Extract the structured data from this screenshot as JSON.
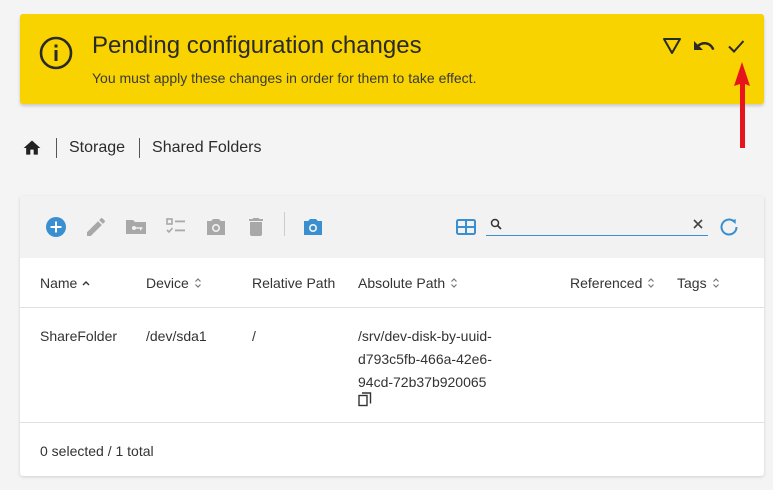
{
  "banner": {
    "title": "Pending configuration changes",
    "subtitle": "You must apply these changes in order for them to take effect.",
    "icons": [
      "info-icon",
      "filter-icon",
      "undo-icon",
      "check-icon"
    ],
    "bg_color": "#f8d300"
  },
  "breadcrumb": {
    "home_icon": "home-icon",
    "items": [
      "Storage",
      "Shared Folders"
    ]
  },
  "toolbar": {
    "icons": [
      "add-icon",
      "edit-icon",
      "folder-key-icon",
      "checklist-icon",
      "snapshot-icon",
      "delete-icon",
      "snapshot-active-icon",
      "grid-icon",
      "refresh-icon"
    ],
    "search_value": "",
    "accent_color": "#3a8fd0"
  },
  "table": {
    "columns": [
      "Name",
      "Device",
      "Relative Path",
      "Absolute Path",
      "Referenced",
      "Tags"
    ],
    "rows": [
      {
        "name": "ShareFolder",
        "device": "/dev/sda1",
        "relative_path": "/",
        "absolute_path_lines": [
          "/srv/dev-disk-by-uuid-",
          "d793c5fb-466a-42e6-",
          "94cd-72b37b920065"
        ],
        "referenced": "",
        "tags": ""
      }
    ],
    "footer": "0 selected / 1 total"
  }
}
